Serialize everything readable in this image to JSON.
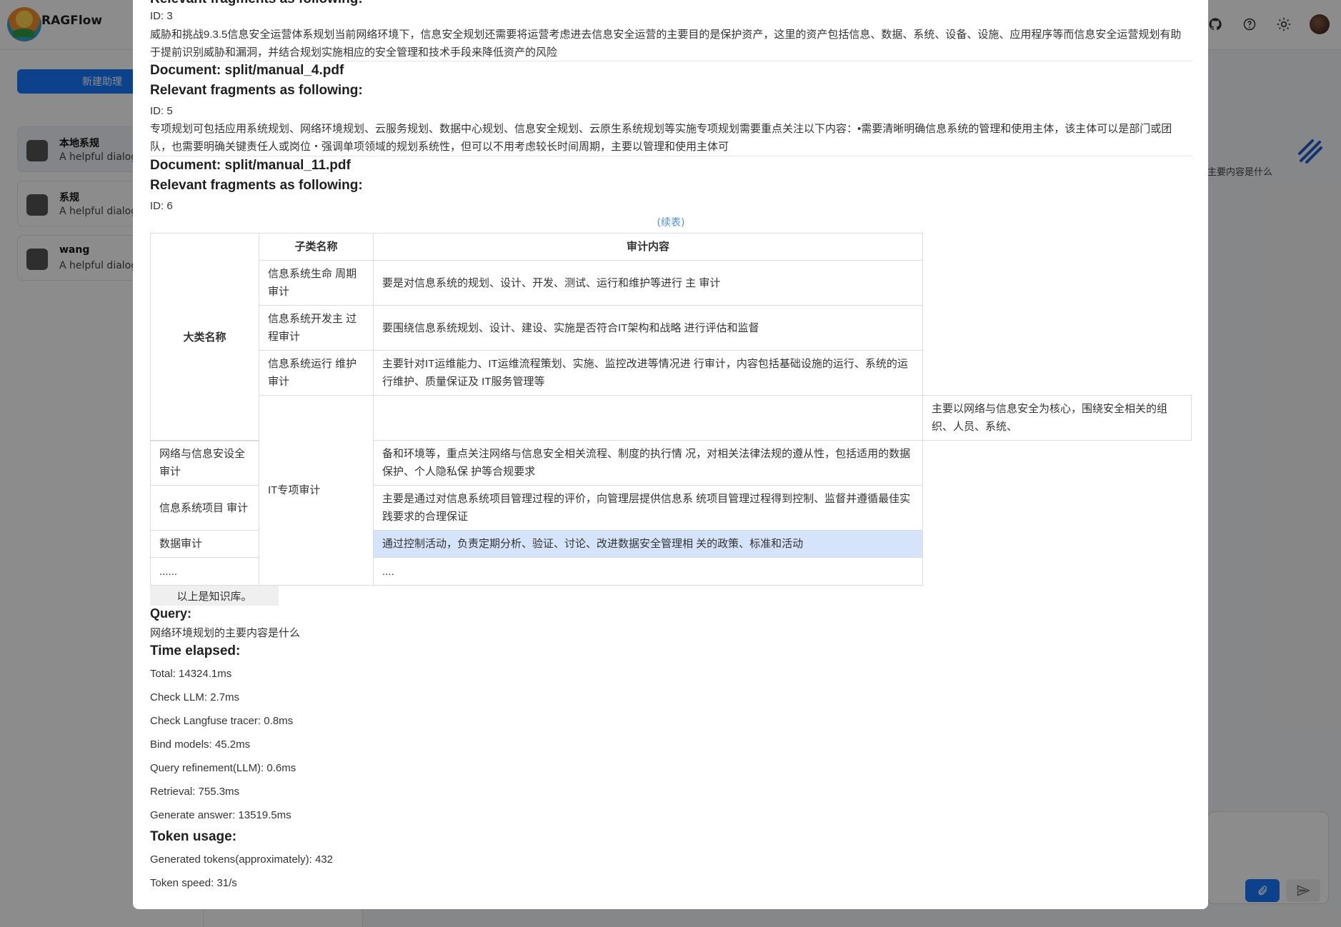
{
  "app": {
    "name": "RAGFlow"
  },
  "sidebar": {
    "new_button": "新建助理",
    "assistants": [
      {
        "name": "本地系规",
        "desc": "A helpful dialog"
      },
      {
        "name": "系规",
        "desc": "A helpful dialog"
      },
      {
        "name": "wang",
        "desc": "A helpful dialog"
      }
    ]
  },
  "right_fragment": "主要内容是什么",
  "modal": {
    "top_heading": "Relevant fragments as following:",
    "blocks": [
      {
        "id": "ID: 3",
        "text": "威胁和挑战9.3.5信息安全运营体系规划当前网络环境下，信息安全规划还需要将运营考虑进去信息安全运营的主要目的是保护资产，这里的资产包括信息、数据、系统、设备、设施、应用程序等而信息安全运营规划有助于提前识别威胁和漏洞，并结合规划实施相应的安全管理和技术手段来降低资产的风险"
      },
      {
        "doc": "Document: split/manual_4.pdf",
        "heading": "Relevant fragments as following:",
        "id": "ID: 5",
        "text": "专项规划可包括应用系统规划、网络环境规划、云服务规划、数据中心规划、信息安全规划、云原生系统规划等实施专项规划需要重点关注以下内容：•需要清晰明确信息系统的管理和使用主体，该主体可以是部门或团队，也需要明确关键责任人或岗位・强调单项领域的规划系统性，但可以不用考虑较长时间周期，主要以管理和使用主体可"
      },
      {
        "doc": "Document: split/manual_11.pdf",
        "heading": "Relevant fragments as following:",
        "id": "ID: 6"
      }
    ],
    "continued": "(续表)",
    "table": {
      "header_big": "大类名称",
      "header_sub": "子类名称",
      "header_audit": "审计内容",
      "rows": [
        {
          "sub": "信息系统生命 周期审计",
          "content": "要是对信息系统的规划、设计、开发、测试、运行和维护等进行 主 审计"
        },
        {
          "sub": "信息系统开发主 过程审计",
          "content": "要围绕信息系统规划、设计、建设、实施是否符合IT架构和战略 进行评估和监督"
        },
        {
          "sub": "信息系统运行 维护审计",
          "content": "主要针对IT运维能力、IT运维流程策划、实施、监控改进等情况进 行审计，内容包括基础设施的运行、系统的运行维护、质量保证及 IT服务管理等"
        }
      ],
      "extra_cell": "主要以网络与信息安全为核心，围绕安全相关的组织、人员、系统、",
      "it_special": "IT专项审计",
      "rows2": [
        {
          "big": "网络与信息安设全审计",
          "content": "备和环境等，重点关注网络与信息安全相关流程、制度的执行情 况，对相关法律法规的遵从性，包括适用的数据保护、个人隐私保 护等合规要求"
        },
        {
          "big": "信息系统项目 审计",
          "content": "主要是通过对信息系统项目管理过程的评价，向管理层提供信息系 统项目管理过程得到控制、监督并遵循最佳实践要求的合理保证"
        },
        {
          "big": "数据审计",
          "content": "通过控制活动，负责定期分析、验证、讨论、改进数据安全管理相 关的政策、标准和活动"
        },
        {
          "big": "......",
          "content": "...."
        }
      ]
    },
    "kb_end": "以上是知识库。",
    "query_label": "Query:",
    "query_text": "网络环境规划的主要内容是什么",
    "time_label": "Time elapsed:",
    "timings": [
      "Total: 14324.1ms",
      "Check LLM: 2.7ms",
      "Check Langfuse tracer: 0.8ms",
      "Bind models: 45.2ms",
      "Query refinement(LLM): 0.6ms",
      "Retrieval: 755.3ms",
      "Generate answer: 13519.5ms"
    ],
    "token_label": "Token usage:",
    "tokens": [
      "Generated tokens(approximately): 432",
      "Token speed: 31/s"
    ]
  }
}
